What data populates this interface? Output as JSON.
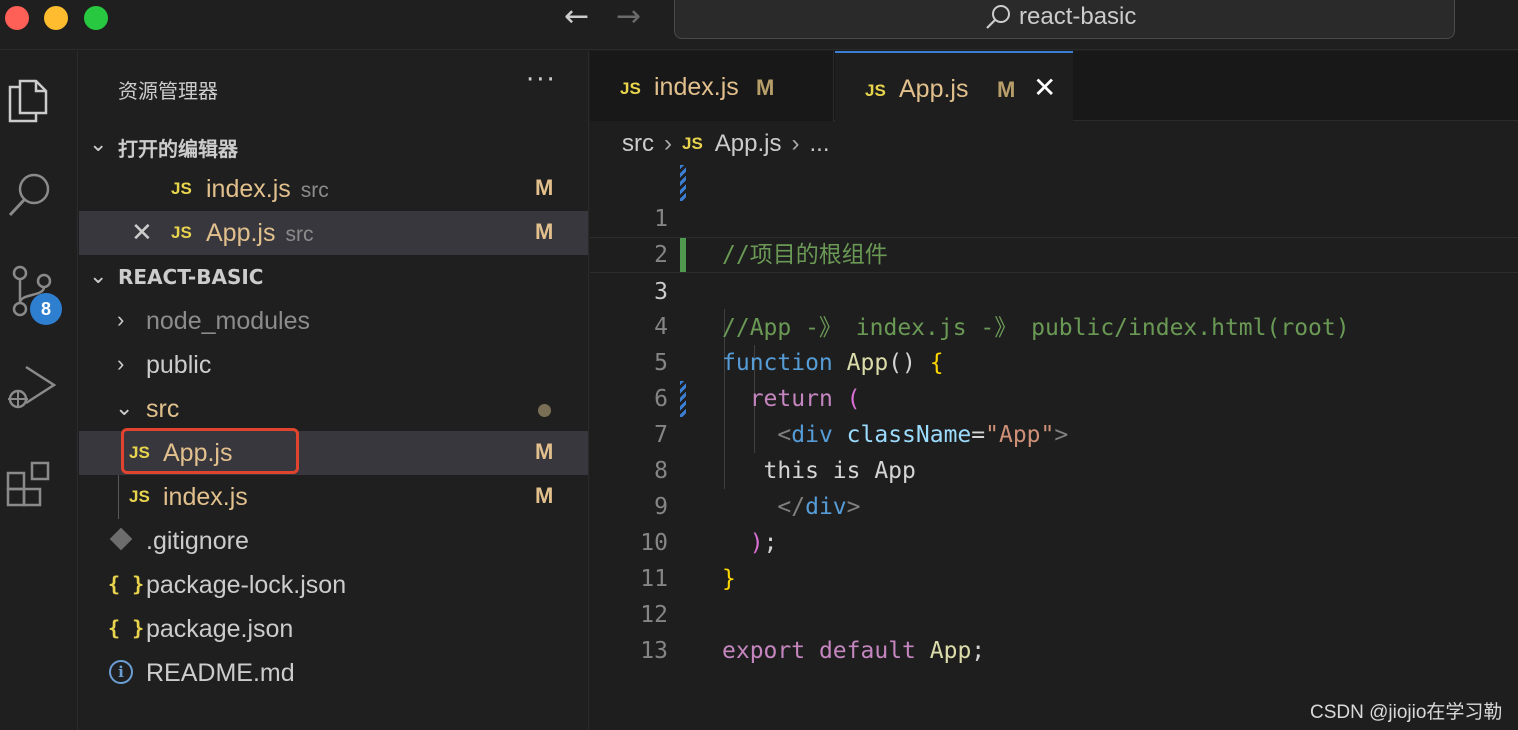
{
  "window": {
    "search_text": "react-basic"
  },
  "activity_bar": {
    "source_control_badge": "8",
    "icons": [
      "explorer-icon",
      "search-icon",
      "source-control-icon",
      "run-debug-icon",
      "extensions-icon"
    ]
  },
  "sidebar": {
    "title": "资源管理器",
    "more": "···",
    "open_editors_header": "打开的编辑器",
    "open_editors": [
      {
        "name": "index.js",
        "desc": "src",
        "status": "M"
      },
      {
        "name": "App.js",
        "desc": "src",
        "status": "M"
      }
    ],
    "project_header": "REACT-BASIC",
    "tree": {
      "node_modules": "node_modules",
      "public": "public",
      "src": "src",
      "app_js": "App.js",
      "app_js_status": "M",
      "index_js": "index.js",
      "index_js_status": "M",
      "gitignore": ".gitignore",
      "package_lock": "package-lock.json",
      "package_json": "package.json",
      "readme": "README.md"
    },
    "js_label": "JS",
    "braces_label": "{ }"
  },
  "tabs": [
    {
      "name": "index.js",
      "status": "M"
    },
    {
      "name": "App.js",
      "status": "M"
    }
  ],
  "breadcrumb": {
    "folder": "src",
    "file": "App.js",
    "more": "..."
  },
  "code": {
    "line_numbers": [
      "1",
      "2",
      "3",
      "4",
      "5",
      "6",
      "7",
      "8",
      "9",
      "10",
      "11",
      "12",
      "13"
    ],
    "l1": "//项目的根组件",
    "l3": "//App -》 index.js -》 public/index.html(root)",
    "l4_kw": "function",
    "l4_fn": "App",
    "l4_parens": "()",
    "l4_brace": "{",
    "l5_kw": "return",
    "l5_paren": "(",
    "l6_open": "<",
    "l6_tag": "div",
    "l6_attr": "className",
    "l6_eq": "=",
    "l6_str": "\"App\"",
    "l6_close": ">",
    "l7_text": "this is App",
    "l8_open": "</",
    "l8_tag": "div",
    "l8_close": ">",
    "l9_paren": ")",
    "l9_semi": ";",
    "l10_brace": "}",
    "l12_kw1": "export",
    "l12_kw2": "default",
    "l12_name": "App",
    "l12_semi": ";"
  },
  "watermark": "CSDN @jiojio在学习勒"
}
